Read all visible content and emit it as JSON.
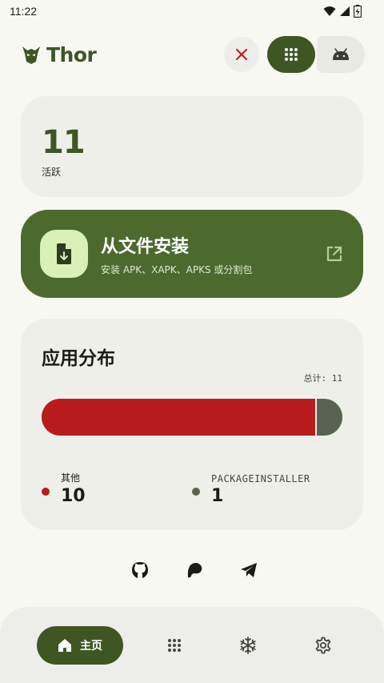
{
  "status_bar": {
    "time": "11:22",
    "icons": [
      "wifi-icon",
      "signal-icon",
      "battery-icon"
    ]
  },
  "header": {
    "app_title": "Thor",
    "logo_icon": "thor-helmet-icon",
    "close_icon": "close-icon",
    "apps_view_icon": "grid-icon",
    "android_view_icon": "android-icon"
  },
  "active_card": {
    "count": "11",
    "label": "活跃"
  },
  "install_card": {
    "title": "从文件安装",
    "subtitle": "安装 APK、XAPK、APKS 或分割包",
    "icon": "file-download-icon",
    "action_icon": "open-external-icon"
  },
  "distribution": {
    "title": "应用分布",
    "total_label": "总计: 11",
    "segments": [
      {
        "name": "其他",
        "value": 10,
        "color": "#b81c1c"
      },
      {
        "name": "PACKAGEINSTALLER",
        "value": 1,
        "color": "#586450"
      }
    ]
  },
  "social_links": [
    "github-icon",
    "patreon-icon",
    "telegram-icon"
  ],
  "bottom_nav": {
    "home_label": "主页",
    "items": [
      "home-icon",
      "apps-grid-icon",
      "freeze-icon",
      "settings-icon"
    ]
  },
  "colors": {
    "primary": "#3f5623",
    "install_bg": "#4c6a2e",
    "error": "#b81c1c",
    "background": "#f8f8f3"
  }
}
